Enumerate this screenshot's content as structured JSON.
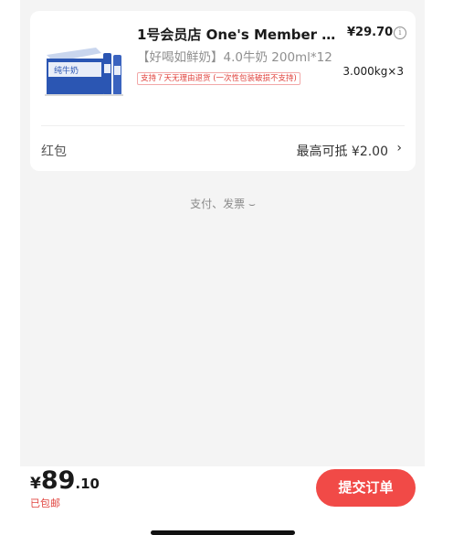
{
  "product": {
    "title": "1号会员店 One's Member 全…",
    "spec": "【好喝如鲜奶】4.0牛奶 200ml*12",
    "return_badge": "支持７天无理由退货 (一次性包装破损不支持)",
    "price": "¥29.70",
    "quantity": "3.000kg×3",
    "info_icon_glyph": "i",
    "thumbnail_icon": "milk-box-image",
    "thumbnail_text": "纯牛奶"
  },
  "hongbao": {
    "label": "红包",
    "value": "最高可抵 ¥2.00",
    "chevron": "›"
  },
  "pay_invoice": "支付、发票 ⌣",
  "footer": {
    "currency": "¥",
    "total_int": "89",
    "total_dec": ".10",
    "shipping": "已包邮",
    "submit_label": "提交订单"
  },
  "colors": {
    "accent": "#f14a47",
    "badge_text": "#e0433e",
    "background": "#f4f4f4"
  }
}
